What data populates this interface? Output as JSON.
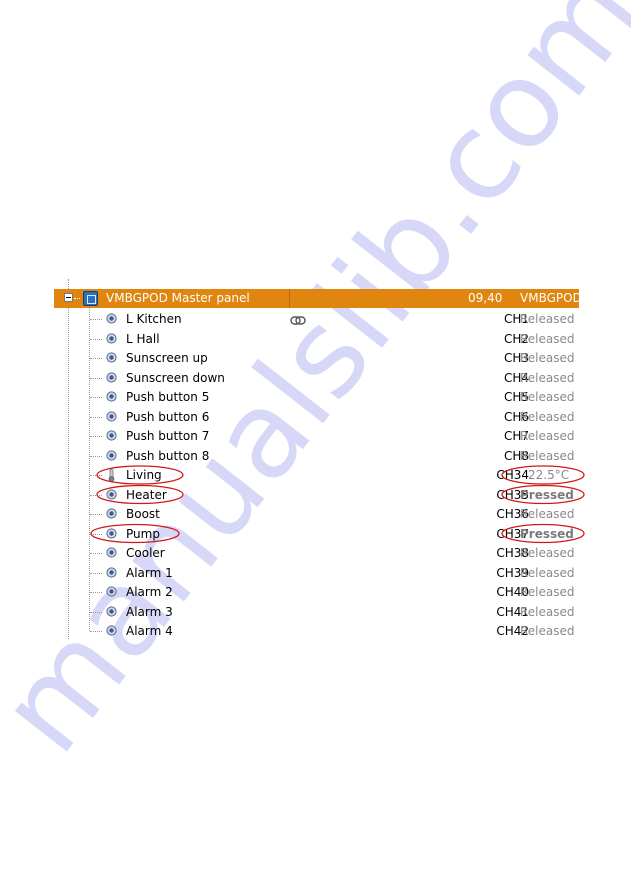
{
  "watermark": "manualslib.com",
  "module": {
    "title": "VMBGPOD Master panel",
    "address": "09,40",
    "type": "VMBGPOD",
    "header_color": "#e0860f"
  },
  "channels": [
    {
      "name": "L Kitchen",
      "channel": "CH1",
      "status": "Released",
      "icon": "pushbutton-icon",
      "linked": true
    },
    {
      "name": "L Hall",
      "channel": "CH2",
      "status": "Released",
      "icon": "pushbutton-icon"
    },
    {
      "name": "Sunscreen up",
      "channel": "CH3",
      "status": "Released",
      "icon": "pushbutton-icon"
    },
    {
      "name": "Sunscreen down",
      "channel": "CH4",
      "status": "Released",
      "icon": "pushbutton-icon"
    },
    {
      "name": "Push button 5",
      "channel": "CH5",
      "status": "Released",
      "icon": "pushbutton-icon"
    },
    {
      "name": "Push button 6",
      "channel": "CH6",
      "status": "Released",
      "icon": "pushbutton-icon"
    },
    {
      "name": "Push button 7",
      "channel": "CH7",
      "status": "Released",
      "icon": "pushbutton-icon"
    },
    {
      "name": "Push button 8",
      "channel": "CH8",
      "status": "Released",
      "icon": "pushbutton-icon"
    },
    {
      "name": "Living",
      "channel": "CH34",
      "status": "22.5°C",
      "icon": "thermometer-icon",
      "highlighted": true
    },
    {
      "name": "Heater",
      "channel": "CH35",
      "status": "Pressed",
      "icon": "pushbutton-icon",
      "highlighted": true
    },
    {
      "name": "Boost",
      "channel": "CH36",
      "status": "Released",
      "icon": "pushbutton-icon"
    },
    {
      "name": "Pump",
      "channel": "CH37",
      "status": "Pressed",
      "icon": "pushbutton-icon",
      "highlighted": true
    },
    {
      "name": "Cooler",
      "channel": "CH38",
      "status": "Released",
      "icon": "pushbutton-icon"
    },
    {
      "name": "Alarm 1",
      "channel": "CH39",
      "status": "Released",
      "icon": "pushbutton-icon"
    },
    {
      "name": "Alarm 2",
      "channel": "CH40",
      "status": "Released",
      "icon": "pushbutton-icon"
    },
    {
      "name": "Alarm 3",
      "channel": "CH41",
      "status": "Released",
      "icon": "pushbutton-icon"
    },
    {
      "name": "Alarm 4",
      "channel": "CH42",
      "status": "Released",
      "icon": "pushbutton-icon"
    }
  ],
  "annotation_color": "#d01818"
}
